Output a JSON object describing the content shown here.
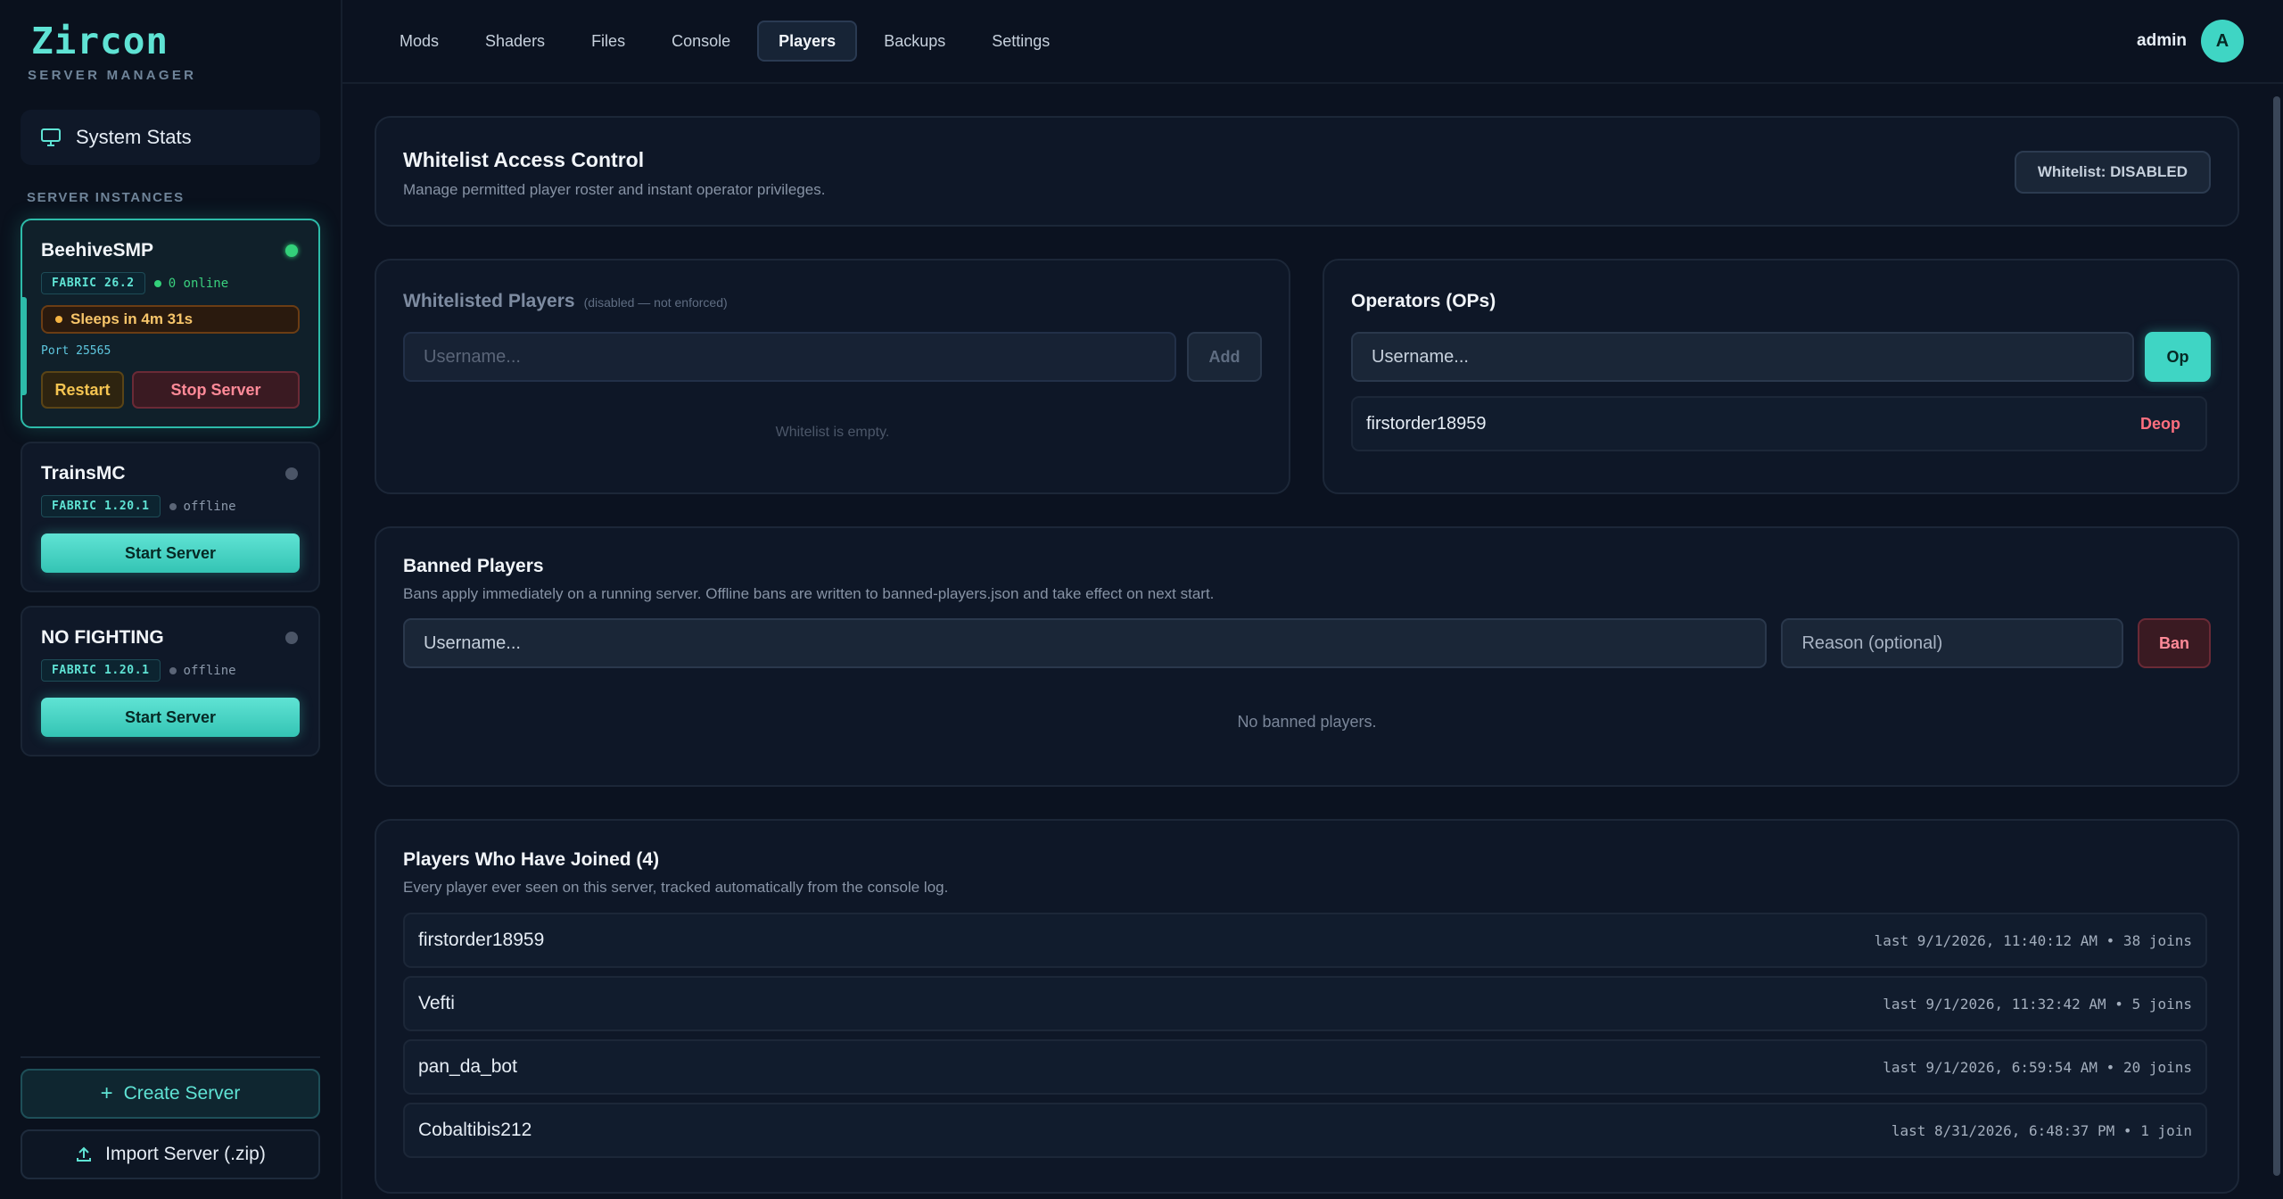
{
  "brand": {
    "logo": "Zircon",
    "subtitle": "SERVER MANAGER"
  },
  "sidebar": {
    "system_stats": "System Stats",
    "section_label": "SERVER INSTANCES",
    "servers": [
      {
        "name": "BeehiveSMP",
        "badge": "FABRIC 26.2",
        "status": "0 online",
        "sleep": "Sleeps in 4m 31s",
        "port": "Port 25565",
        "restart": "Restart",
        "stop": "Stop Server"
      },
      {
        "name": "TrainsMC",
        "badge": "FABRIC 1.20.1",
        "status": "offline",
        "start": "Start Server"
      },
      {
        "name": "NO FIGHTING",
        "badge": "FABRIC 1.20.1",
        "status": "offline",
        "start": "Start Server"
      }
    ],
    "create": "Create Server",
    "import": "Import Server (.zip)"
  },
  "topbar": {
    "tabs": [
      "Mods",
      "Shaders",
      "Files",
      "Console",
      "Players",
      "Backups",
      "Settings"
    ],
    "active_tab": "Players",
    "user": "admin",
    "avatar_letter": "A"
  },
  "whitelist_header": {
    "title": "Whitelist Access Control",
    "subtitle": "Manage permitted player roster and instant operator privileges.",
    "toggle": "Whitelist: DISABLED"
  },
  "whitelist": {
    "title": "Whitelisted Players",
    "note": "(disabled — not enforced)",
    "placeholder": "Username...",
    "add": "Add",
    "empty": "Whitelist is empty."
  },
  "operators": {
    "title": "Operators (OPs)",
    "placeholder": "Username...",
    "op": "Op",
    "list": [
      {
        "name": "firstorder18959",
        "action": "Deop"
      }
    ]
  },
  "banned": {
    "title": "Banned Players",
    "subtitle": "Bans apply immediately on a running server. Offline bans are written to banned-players.json and take effect on next start.",
    "user_placeholder": "Username...",
    "reason_placeholder": "Reason (optional)",
    "ban": "Ban",
    "empty": "No banned players."
  },
  "joined": {
    "title": "Players Who Have Joined (4)",
    "subtitle": "Every player ever seen on this server, tracked automatically from the console log.",
    "players": [
      {
        "name": "firstorder18959",
        "meta": "last 9/1/2026, 11:40:12 AM • 38 joins"
      },
      {
        "name": "Vefti",
        "meta": "last 9/1/2026, 11:32:42 AM • 5 joins"
      },
      {
        "name": "pan_da_bot",
        "meta": "last 9/1/2026, 6:59:54 AM • 20 joins"
      },
      {
        "name": "Cobaltibis212",
        "meta": "last 8/31/2026, 6:48:37 PM • 1 join"
      }
    ]
  },
  "colors": {
    "accent": "#3fd5c4",
    "online": "#33d17a",
    "danger": "#ff6f7f",
    "warning": "#f5c451"
  }
}
